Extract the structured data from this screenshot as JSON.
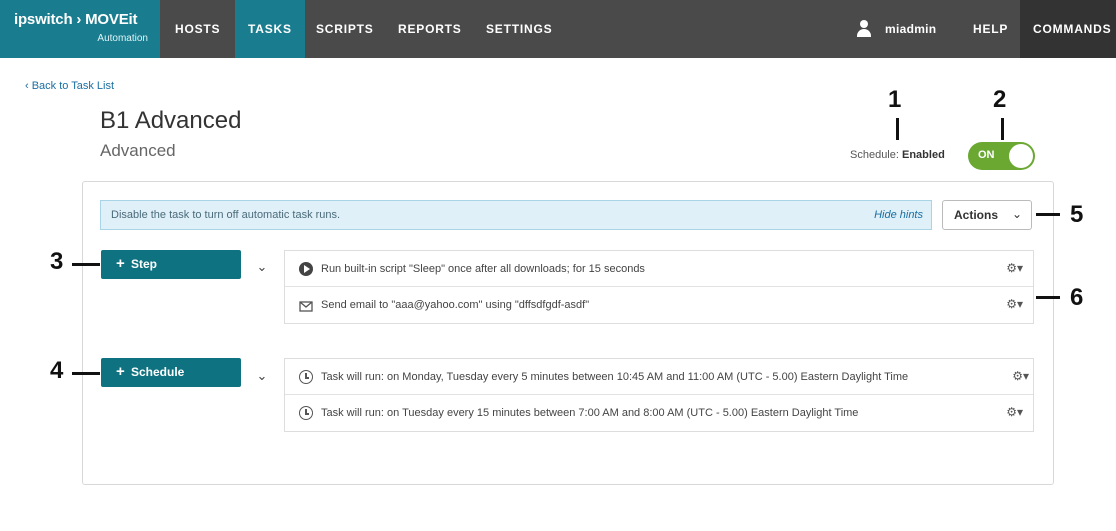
{
  "brand": {
    "name": "ipswitch › MOVEit",
    "product": "Automation"
  },
  "nav": {
    "hosts": "HOSTS",
    "tasks": "TASKS",
    "scripts": "SCRIPTS",
    "reports": "REPORTS",
    "settings": "SETTINGS",
    "user": "miadmin",
    "help": "HELP",
    "commands": "COMMANDS"
  },
  "page": {
    "back_link": "‹ Back to Task List",
    "title": "B1 Advanced",
    "subtitle": "Advanced",
    "schedule_label": "Schedule:",
    "schedule_value": "Enabled",
    "toggle_label": "ON"
  },
  "hint": {
    "text": "Disable the task to turn off automatic task runs.",
    "hide": "Hide hints"
  },
  "actions": {
    "label": "Actions",
    "chevron": "⌄"
  },
  "steps": {
    "button_label": "Step",
    "items": [
      {
        "icon": "play-icon",
        "text": "Run built-in script \"Sleep\" once after all downloads; for 15 seconds"
      },
      {
        "icon": "envelope-icon",
        "text": "Send email to \"aaa@yahoo.com\" using \"dffsdfgdf-asdf\""
      }
    ]
  },
  "schedules": {
    "button_label": "Schedule",
    "items": [
      {
        "icon": "clock-icon",
        "text": "Task will run: on Monday, Tuesday every 5 minutes between 10:45 AM and 11:00 AM (UTC - 5.00) Eastern Daylight Time"
      },
      {
        "icon": "clock-icon",
        "text": "Task will run: on Tuesday every 15 minutes between 7:00 AM and 8:00 AM (UTC - 5.00) Eastern Daylight Time"
      }
    ]
  },
  "callouts": {
    "c1": "1",
    "c2": "2",
    "c3": "3",
    "c4": "4",
    "c5": "5",
    "c6": "6"
  },
  "glyphs": {
    "plus": "+",
    "caret": "⌄",
    "gear": "⚙▾"
  },
  "colors": {
    "nav_bg": "#4a4a4a",
    "teal": "#0f7280",
    "toggle_on": "#6aa832",
    "hint_bg": "#dff0f8"
  }
}
